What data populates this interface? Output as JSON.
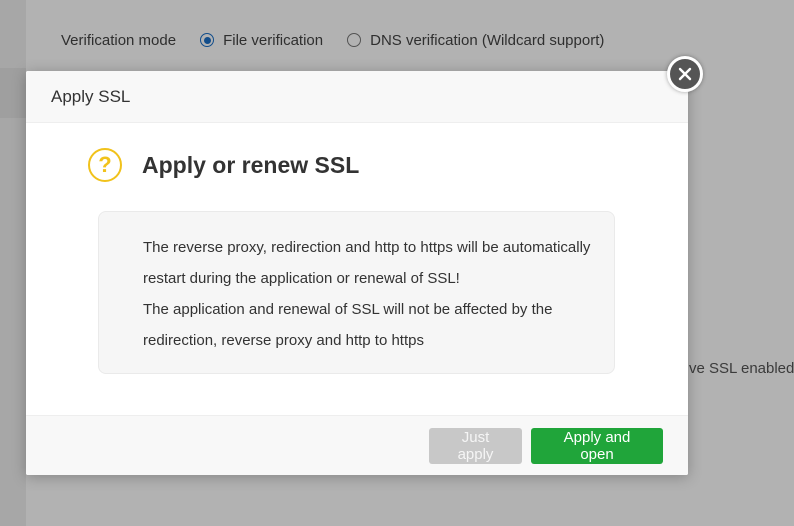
{
  "background": {
    "verification_label": "Verification mode",
    "options": [
      {
        "label": "File verification",
        "selected": true
      },
      {
        "label": "DNS verification (Wildcard support)",
        "selected": false
      }
    ],
    "truncated_text": "ve SSL enabled, y"
  },
  "dialog": {
    "header_title": "Apply SSL",
    "heading": "Apply or renew SSL",
    "icon": "question-icon",
    "icon_color": "#f1c21b",
    "message_lines": [
      "The reverse proxy, redirection and http to https will be automatically",
      "restart during the application or renewal of SSL!",
      "The application and renewal of SSL will not be affected by the",
      "redirection, reverse proxy and http to https"
    ],
    "buttons": {
      "just_apply": "Just apply",
      "apply_and_open": "Apply and open"
    },
    "accent_color": "#20a53a",
    "close_icon": "close-icon"
  }
}
